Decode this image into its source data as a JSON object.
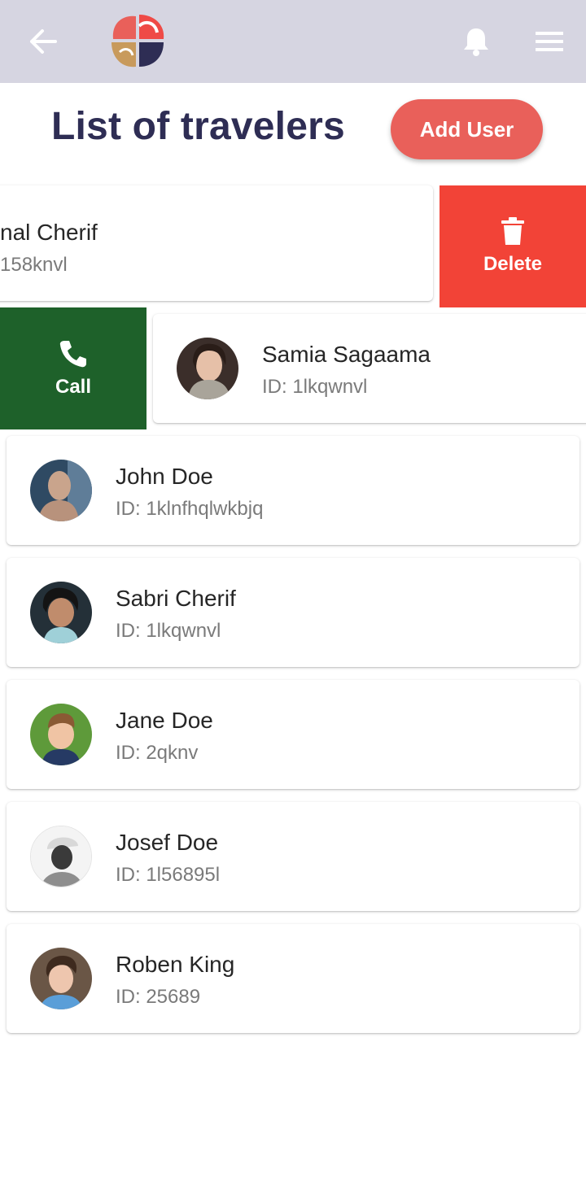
{
  "header": {
    "back_icon": "arrow-left-icon",
    "logo_icon": "app-logo",
    "bell_icon": "bell-icon",
    "menu_icon": "hamburger-menu-icon"
  },
  "page": {
    "title": "List of travelers",
    "add_user_label": "Add User"
  },
  "swipe_actions": {
    "delete_label": "Delete",
    "delete_icon": "trash-icon",
    "call_label": "Call",
    "call_icon": "phone-icon"
  },
  "travelers": [
    {
      "name": "nal Cherif",
      "id": "158knvl"
    },
    {
      "name": "Samia Sagaama",
      "id": "ID: 1lkqwnvl"
    },
    {
      "name": "John Doe",
      "id": "ID: 1klnfhqlwkbjq"
    },
    {
      "name": "Sabri Cherif",
      "id": "ID: 1lkqwnvl"
    },
    {
      "name": "Jane Doe",
      "id": "ID: 2qknv"
    },
    {
      "name": "Josef Doe",
      "id": "ID: 1l56895l"
    },
    {
      "name": "Roben King",
      "id": "ID: 25689"
    }
  ],
  "colors": {
    "header_bg": "#d6d5e1",
    "title": "#2e2d54",
    "add_button": "#e9605a",
    "delete": "#f24337",
    "call": "#1e612a"
  }
}
